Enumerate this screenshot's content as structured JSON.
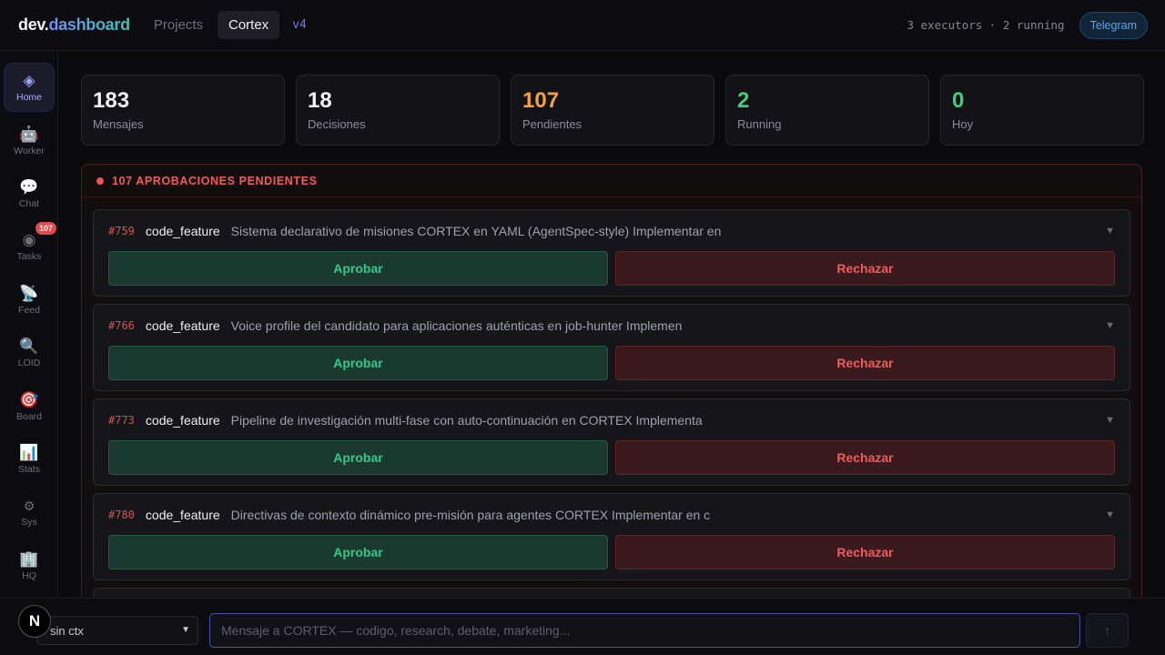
{
  "app": {
    "logo_main": "dev.",
    "logo_accent": "dashboard",
    "tabs": [
      {
        "label": "Projects",
        "active": false
      },
      {
        "label": "Cortex",
        "active": true
      }
    ],
    "version": "v4",
    "executor_status": "3 executors · 2 running",
    "telegram_label": "Telegram"
  },
  "sidebar": {
    "items": [
      {
        "label": "Home",
        "icon": "diamond-icon",
        "glyph": "◈",
        "active": true
      },
      {
        "label": "Worker",
        "icon": "robot-icon",
        "glyph": "🤖"
      },
      {
        "label": "Chat",
        "icon": "speech-bubble-icon",
        "glyph": "💬"
      },
      {
        "label": "Tasks",
        "icon": "radio-button-icon",
        "glyph": "◉",
        "badge": "107"
      },
      {
        "label": "Feed",
        "icon": "satellite-icon",
        "glyph": "📡"
      },
      {
        "label": "LOID",
        "icon": "magnifier-icon",
        "glyph": "🔍"
      },
      {
        "label": "Board",
        "icon": "target-icon",
        "glyph": "🎯"
      },
      {
        "label": "Stats",
        "icon": "bar-chart-icon",
        "glyph": "📊"
      },
      {
        "label": "Sys",
        "icon": "gear-icon",
        "glyph": "⚙"
      },
      {
        "label": "HQ",
        "icon": "building-icon",
        "glyph": "🏢"
      }
    ]
  },
  "stats": [
    {
      "value": "183",
      "label": "Mensajes",
      "color": "default"
    },
    {
      "value": "18",
      "label": "Decisiones",
      "color": "default"
    },
    {
      "value": "107",
      "label": "Pendientes",
      "color": "orange"
    },
    {
      "value": "2",
      "label": "Running",
      "color": "green"
    },
    {
      "value": "0",
      "label": "Hoy",
      "color": "green"
    }
  ],
  "approvals": {
    "title": "107 APROBACIONES PENDIENTES",
    "approve_label": "Aprobar",
    "reject_label": "Rechazar",
    "items": [
      {
        "id": "#759",
        "type": "code_feature",
        "desc": "Sistema declarativo de misiones CORTEX en YAML (AgentSpec-style) Implementar en"
      },
      {
        "id": "#766",
        "type": "code_feature",
        "desc": "Voice profile del candidato para aplicaciones auténticas en job-hunter Implemen"
      },
      {
        "id": "#773",
        "type": "code_feature",
        "desc": "Pipeline de investigación multi-fase con auto-continuación en CORTEX Implementa"
      },
      {
        "id": "#780",
        "type": "code_feature",
        "desc": "Directivas de contexto dinámico pre-misión para agentes CORTEX Implementar en c"
      }
    ]
  },
  "composer": {
    "context_value": "sin ctx",
    "placeholder": "Mensaje a CORTEX — codigo, research, debate, marketing...",
    "send_icon": "arrow-up-icon",
    "avatar_letter": "N"
  },
  "colors": {
    "accent": "#6d8ff5",
    "approve": "#34c98a",
    "reject": "#f05a5f",
    "pending": "#f5a23c",
    "running": "#3ecf7e"
  }
}
